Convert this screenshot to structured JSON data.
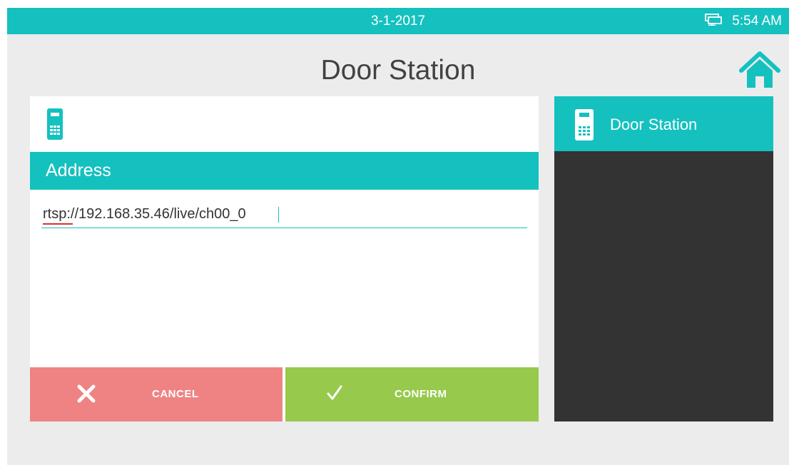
{
  "status_bar": {
    "date": "3-1-2017",
    "time": "5:54 AM",
    "network_icon": "network-icon"
  },
  "page": {
    "title": "Door Station",
    "home_icon": "home-icon"
  },
  "editor": {
    "device_icon": "door-station-icon",
    "section_title": "Address",
    "address_value": "rtsp://192.168.35.46/live/ch00_0"
  },
  "actions": {
    "cancel": {
      "label": "CANCEL",
      "icon": "close-icon"
    },
    "confirm": {
      "label": "CONFIRM",
      "icon": "check-icon"
    }
  },
  "device_list": {
    "items": [
      {
        "label": "Door Station",
        "icon": "door-station-icon",
        "selected": true
      }
    ]
  },
  "colors": {
    "accent": "#14c1bf",
    "cancel": "#ef8383",
    "confirm": "#97c94d",
    "list_background": "#333333",
    "background": "#ececec"
  }
}
